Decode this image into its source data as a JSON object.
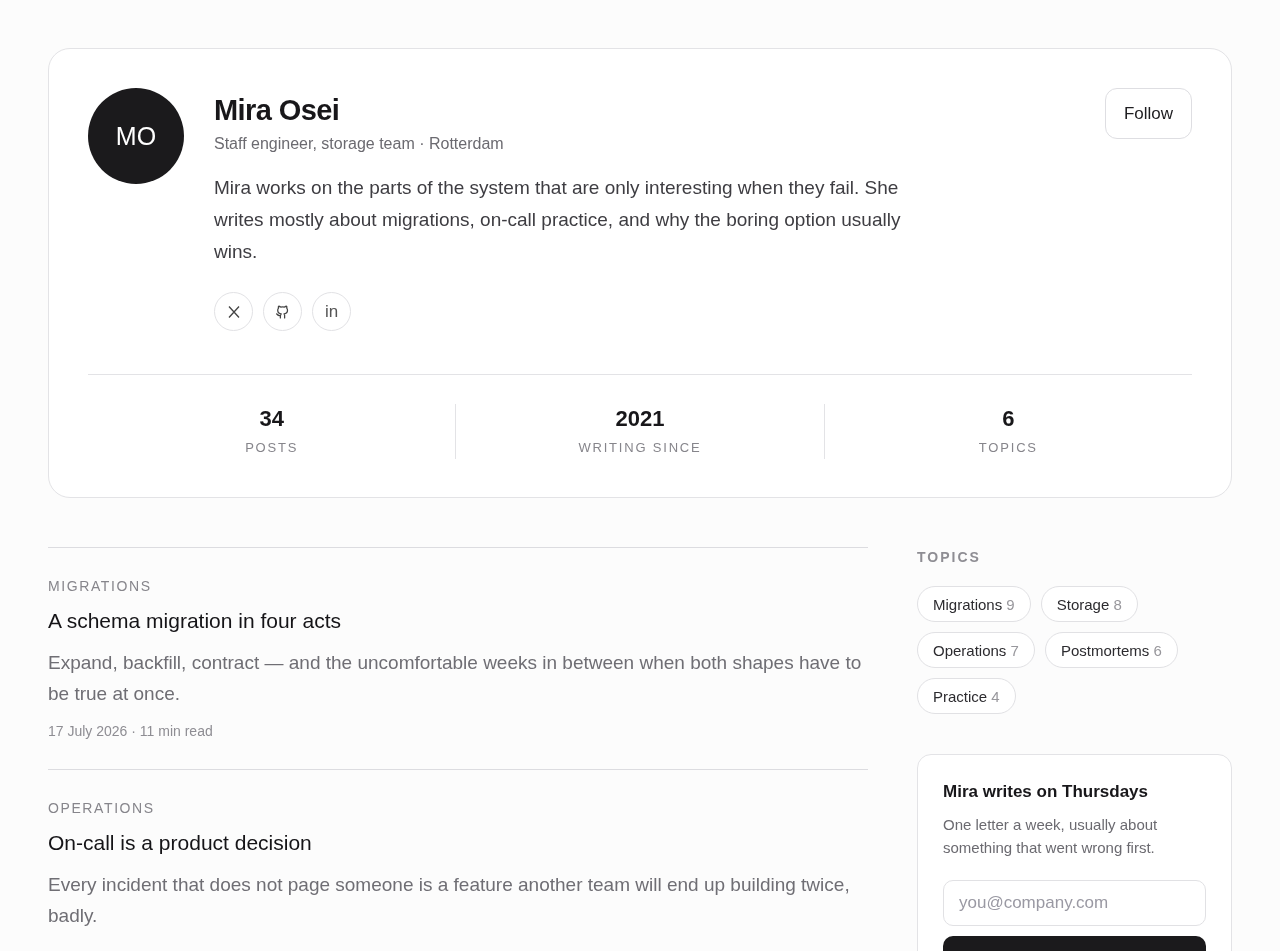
{
  "profile": {
    "initials": "MO",
    "name": "Mira Osei",
    "role": "Staff engineer, storage team · Rotterdam",
    "bio": "Mira works on the parts of the system that are only interesting when they fail. She writes mostly about migrations, on-call practice, and why the boring option usually wins.",
    "follow": "Follow",
    "socials": [
      {
        "kind": "x"
      },
      {
        "kind": "github"
      },
      {
        "kind": "linkedin",
        "label": "in"
      }
    ],
    "stats": [
      {
        "value": "34",
        "label": "POSTS"
      },
      {
        "value": "2021",
        "label": "WRITING SINCE"
      },
      {
        "value": "6",
        "label": "TOPICS"
      }
    ]
  },
  "posts": [
    {
      "category": "MIGRATIONS",
      "title": "A schema migration in four acts",
      "excerpt": "Expand, backfill, contract — and the uncomfortable weeks in between when both shapes have to be true at once.",
      "meta": "17 July 2026 · 11 min read"
    },
    {
      "category": "OPERATIONS",
      "title": "On-call is a product decision",
      "excerpt": "Every incident that does not page someone is a feature another team will end up building twice, badly."
    }
  ],
  "topics": {
    "heading": "TOPICS",
    "items": [
      {
        "name": "Migrations",
        "count": "9"
      },
      {
        "name": "Storage",
        "count": "8"
      },
      {
        "name": "Operations",
        "count": "7"
      },
      {
        "name": "Postmortems",
        "count": "6"
      },
      {
        "name": "Practice",
        "count": "4"
      }
    ]
  },
  "newsletter": {
    "title": "Mira writes on Thursdays",
    "text": "One letter a week, usually about something that went wrong first.",
    "placeholder": "you@company.com"
  }
}
